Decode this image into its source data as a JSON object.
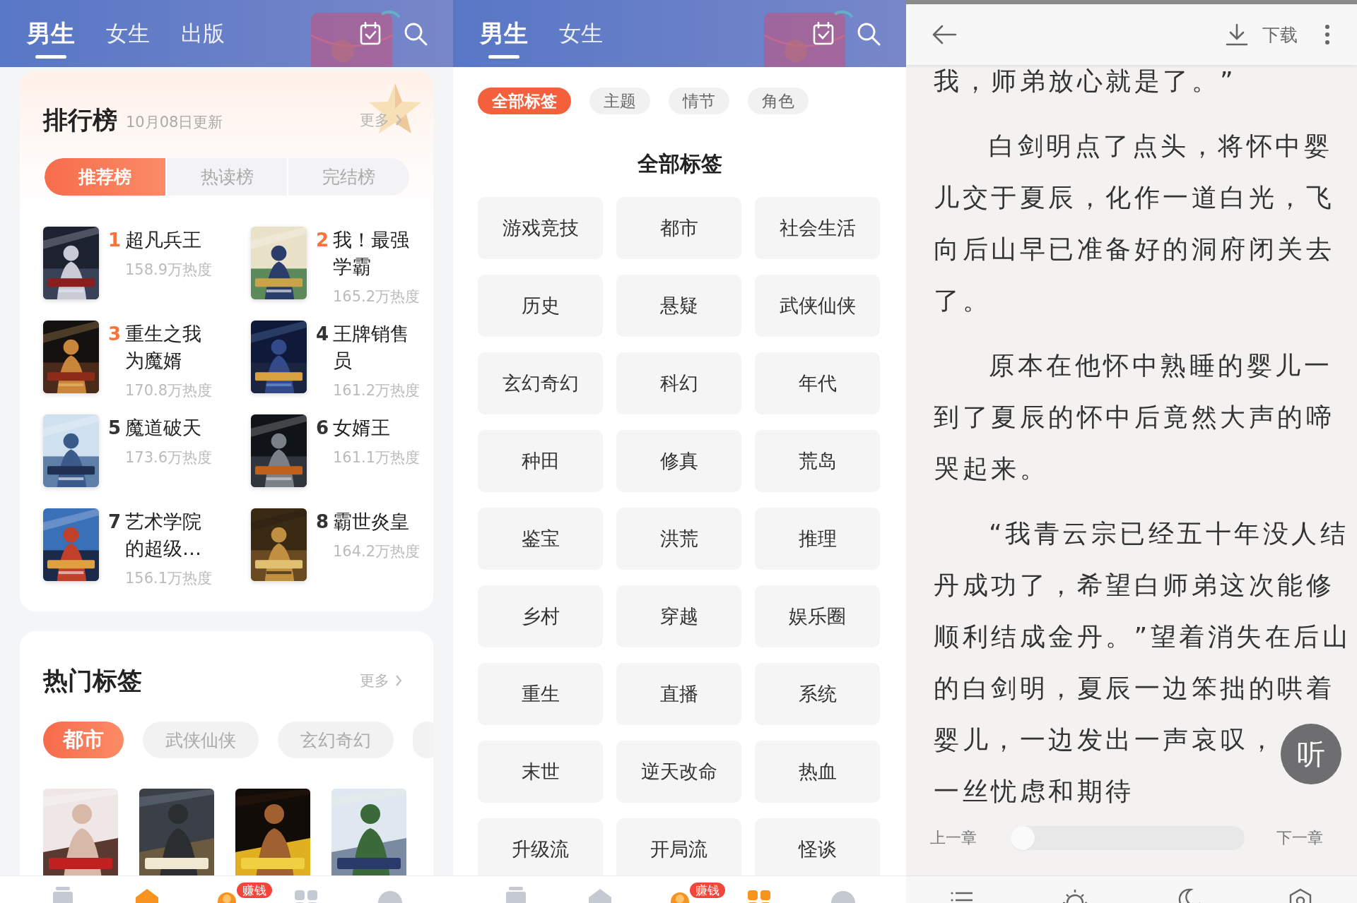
{
  "home": {
    "tabs": [
      {
        "label": "男生",
        "selected": true
      },
      {
        "label": "女生",
        "selected": false
      },
      {
        "label": "出版",
        "selected": false
      }
    ],
    "ranking": {
      "title": "排行榜",
      "updated": "10月08日更新",
      "more": "更多",
      "tabs": [
        {
          "label": "推荐榜",
          "selected": true
        },
        {
          "label": "热读榜",
          "selected": false
        },
        {
          "label": "完结榜",
          "selected": false
        }
      ],
      "books": [
        {
          "rank": "1",
          "highlighted": true,
          "title": "超凡兵王",
          "heat": "158.9万热度"
        },
        {
          "rank": "2",
          "highlighted": true,
          "title": "我！最强学霸",
          "heat": "165.2万热度"
        },
        {
          "rank": "3",
          "highlighted": true,
          "title": "重生之我为魔婿",
          "heat": "170.8万热度"
        },
        {
          "rank": "4",
          "highlighted": false,
          "title": "王牌销售员",
          "heat": "161.2万热度"
        },
        {
          "rank": "5",
          "highlighted": false,
          "title": "魔道破天",
          "heat": "173.6万热度"
        },
        {
          "rank": "6",
          "highlighted": false,
          "title": "女婿王",
          "heat": "161.1万热度"
        },
        {
          "rank": "7",
          "highlighted": false,
          "title": "艺术学院的超级…",
          "heat": "156.1万热度"
        },
        {
          "rank": "8",
          "highlighted": false,
          "title": "霸世炎皇",
          "heat": "164.2万热度"
        }
      ]
    },
    "hot_tags": {
      "title": "热门标签",
      "more": "更多",
      "tags": [
        {
          "label": "都市",
          "selected": true
        },
        {
          "label": "武侠仙侠",
          "selected": false
        },
        {
          "label": "玄幻奇幻",
          "selected": false
        }
      ]
    },
    "nav": [
      {
        "kind": "shelf",
        "selected": false
      },
      {
        "kind": "home",
        "selected": true
      },
      {
        "kind": "rewards",
        "selected": false,
        "badge": "赚钱"
      },
      {
        "kind": "categories",
        "selected": false
      },
      {
        "kind": "profile",
        "selected": false
      }
    ]
  },
  "categories": {
    "tabs": [
      {
        "label": "男生",
        "selected": true
      },
      {
        "label": "女生",
        "selected": false
      }
    ],
    "filters": [
      {
        "label": "全部标签",
        "selected": true
      },
      {
        "label": "主题",
        "selected": false
      },
      {
        "label": "情节",
        "selected": false
      },
      {
        "label": "角色",
        "selected": false
      }
    ],
    "heading": "全部标签",
    "tags": [
      "游戏竞技",
      "都市",
      "社会生活",
      "历史",
      "悬疑",
      "武侠仙侠",
      "玄幻奇幻",
      "科幻",
      "年代",
      "种田",
      "修真",
      "荒岛",
      "鉴宝",
      "洪荒",
      "推理",
      "乡村",
      "穿越",
      "娱乐圈",
      "重生",
      "直播",
      "系统",
      "末世",
      "逆天改命",
      "热血",
      "升级流",
      "开局流",
      "怪谈"
    ],
    "nav": [
      {
        "kind": "shelf",
        "selected": false
      },
      {
        "kind": "home",
        "selected": false
      },
      {
        "kind": "rewards",
        "selected": false,
        "badge": "赚钱"
      },
      {
        "kind": "categories",
        "selected": true
      },
      {
        "kind": "profile",
        "selected": false
      }
    ]
  },
  "reader": {
    "download": "下载",
    "paragraphs": [
      {
        "lines": [
          "我，师弟放心就是了。”"
        ],
        "indent": false
      },
      {
        "lines": [
          "白剑明点了点头，将怀中婴",
          "儿交于夏辰，化作一道白光，飞",
          "向后山早已准备好的洞府闭关去",
          "了。"
        ],
        "indent": true
      },
      {
        "lines": [
          "原本在他怀中熟睡的婴儿一",
          "到了夏辰的怀中后竟然大声的啼",
          "哭起来。"
        ],
        "indent": true
      },
      {
        "lines": [
          "“我青云宗已经五十年没人结",
          "丹成功了，希望白师弟这次能修",
          "顺利结成金丹。”望着消失在后山",
          "的白剑明，夏辰一边笨拙的哄着"
        ],
        "indent": true
      }
    ],
    "partial_lines": [
      "婴儿，一边发出一声哀叹，",
      "一丝忧虑和期待"
    ],
    "listen": "听",
    "prev": "上一章",
    "next": "下一章",
    "progress": {
      "level": 0
    }
  }
}
